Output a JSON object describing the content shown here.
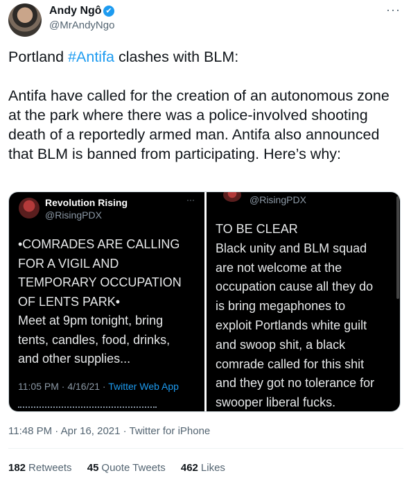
{
  "author": {
    "name": "Andy Ngô",
    "handle": "@MrAndyNgo",
    "verified_icon": "✔"
  },
  "more_icon": "···",
  "tweet": {
    "line1_pre": "Portland ",
    "line1_hashtag": "#Antifa",
    "line1_post": " clashes with BLM:",
    "body": "Antifa have called for the creation of an autonomous zone at the park where there was a police-involved shooting death of a reportedly armed man. Antifa also announced that BLM is banned from participating. Here’s why:"
  },
  "media": {
    "image1": {
      "name": "Revolution Rising",
      "handle": "@RisingPDX",
      "more": "···",
      "lines": [
        "•COMRADES ARE CALLING",
        "FOR A VIGIL AND",
        "TEMPORARY OCCUPATION",
        "OF LENTS PARK•",
        "Meet at 9pm tonight, bring",
        "tents, candles, food, drinks,",
        "and other supplies..."
      ],
      "meta_time": "11:05 PM · 4/16/21 · ",
      "meta_app": "Twitter Web App"
    },
    "image2": {
      "handle": "@RisingPDX",
      "lines": [
        "TO BE CLEAR",
        "Black unity and BLM squad",
        "are not welcome at the",
        "occupation cause all they do",
        "is bring megaphones to",
        "exploit Portlands white guilt",
        "and swoop shit, a black",
        "comrade called for this shit",
        "and they got no tolerance for",
        "swooper liberal fucks."
      ]
    }
  },
  "timestamp": "11:48 PM · Apr 16, 2021 · Twitter for iPhone",
  "stats": {
    "retweets_count": "182",
    "retweets_label": "Retweets",
    "quotes_count": "45",
    "quotes_label": "Quote Tweets",
    "likes_count": "462",
    "likes_label": "Likes"
  }
}
